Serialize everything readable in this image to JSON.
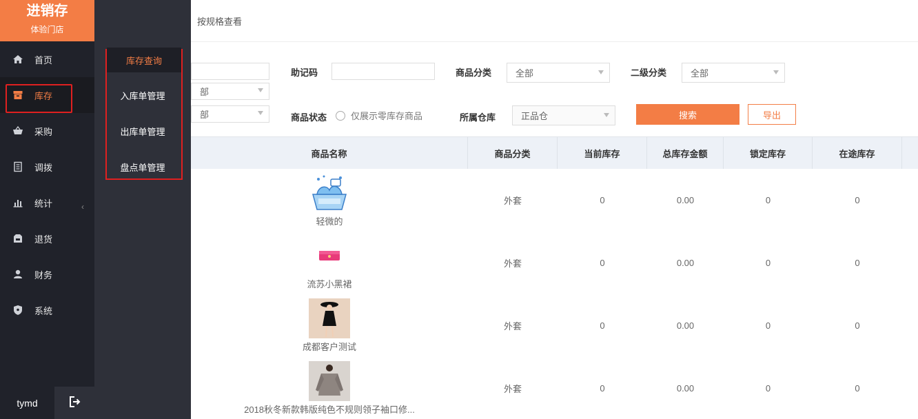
{
  "brand": {
    "title": "进销存",
    "subtitle": "体验门店"
  },
  "nav": [
    {
      "label": "首页",
      "icon": "home-icon"
    },
    {
      "label": "库存",
      "icon": "inventory-icon",
      "active": true
    },
    {
      "label": "采购",
      "icon": "basket-icon"
    },
    {
      "label": "调拨",
      "icon": "document-icon"
    },
    {
      "label": "统计",
      "icon": "bar-chart-icon"
    },
    {
      "label": "退货",
      "icon": "return-icon"
    },
    {
      "label": "财务",
      "icon": "user-icon"
    },
    {
      "label": "系统",
      "icon": "shield-icon"
    }
  ],
  "user": {
    "name": "tymd"
  },
  "submenu": [
    {
      "label": "库存查询",
      "active": true
    },
    {
      "label": "入库单管理"
    },
    {
      "label": "出库单管理"
    },
    {
      "label": "盘点单管理"
    }
  ],
  "tab": {
    "label": "按规格查看"
  },
  "filters": {
    "mnemonic_label": "助记码",
    "category_label": "商品分类",
    "category_value": "全部",
    "subcategory_label": "二级分类",
    "subcategory_value": "全部",
    "left_select1_value": "部",
    "left_select2_value": "部",
    "status_label": "商品状态",
    "zero_stock_label": "仅展示零库存商品",
    "warehouse_label": "所属仓库",
    "warehouse_value": "正品仓",
    "search_label": "搜索",
    "export_label": "导出"
  },
  "table": {
    "headers": [
      "商品名称",
      "商品分类",
      "当前库存",
      "总库存金额",
      "锁定库存",
      "在途库存"
    ],
    "rows": [
      {
        "name": "轻微的",
        "category": "外套",
        "stock": "0",
        "amount": "0.00",
        "locked": "0",
        "transit": "0",
        "thumb": "bag-illustration"
      },
      {
        "name": "流苏小黑裙",
        "category": "外套",
        "stock": "0",
        "amount": "0.00",
        "locked": "0",
        "transit": "0",
        "thumb": "pink-wallet"
      },
      {
        "name": "成都客户测试",
        "category": "外套",
        "stock": "0",
        "amount": "0.00",
        "locked": "0",
        "transit": "0",
        "thumb": "black-dress-photo"
      },
      {
        "name": "2018秋冬新款韩版纯色不规则领子袖口修...",
        "category": "外套",
        "stock": "0",
        "amount": "0.00",
        "locked": "0",
        "transit": "0",
        "thumb": "sweater-photo"
      }
    ]
  },
  "colors": {
    "accent": "#f37d45",
    "sidebar": "#20222a",
    "submenu": "#2e3039",
    "highlight_box": "#e02020"
  }
}
